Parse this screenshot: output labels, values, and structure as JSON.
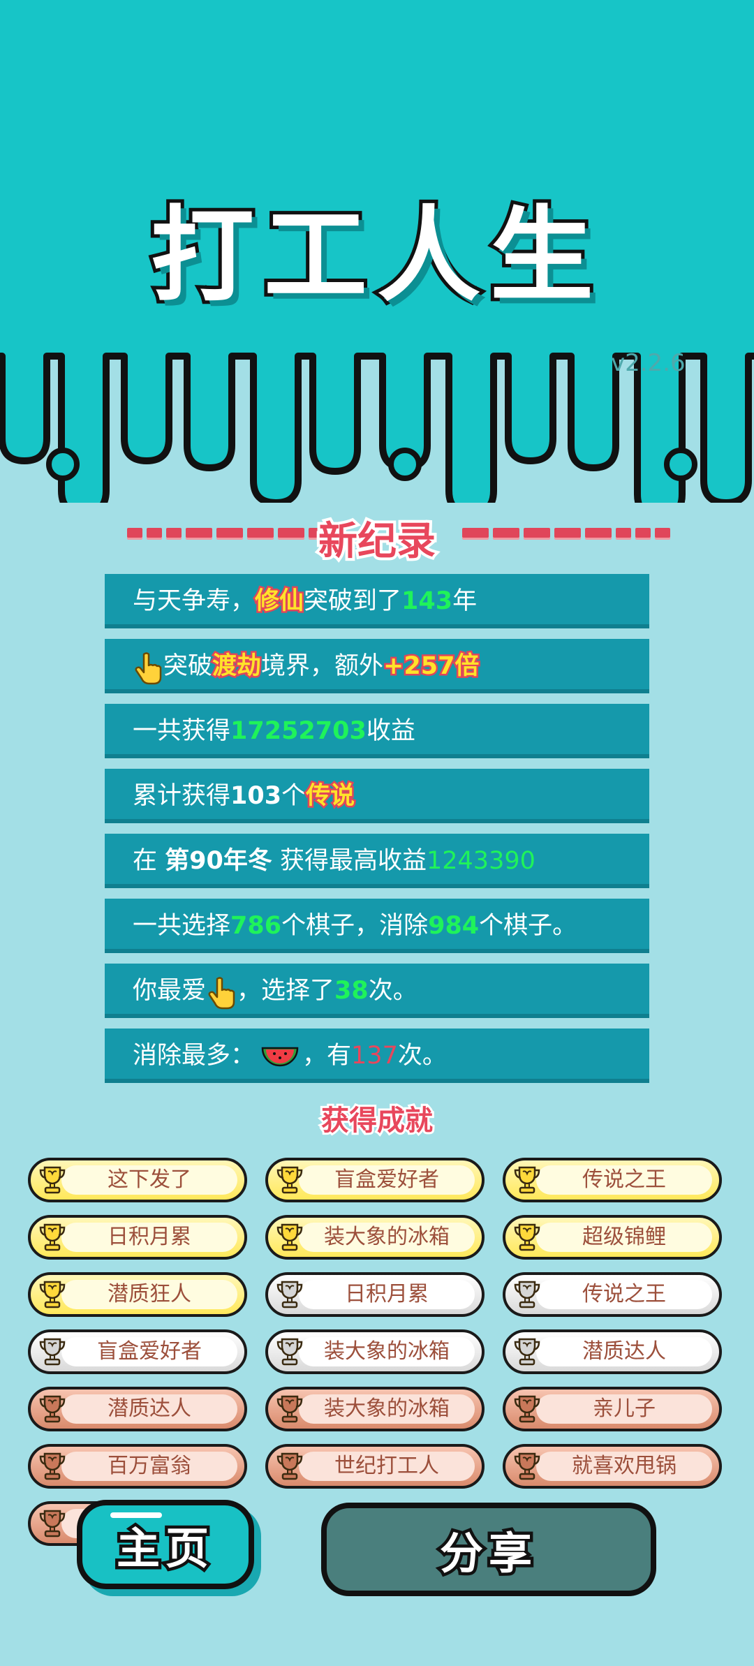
{
  "game": {
    "title": "打工人生",
    "version": "v2.2.6"
  },
  "record": {
    "title": "新纪录",
    "rows": [
      {
        "parts": [
          {
            "t": "与天争寿，"
          },
          {
            "t": "修仙",
            "s": "yellow"
          },
          {
            "t": "突破到了"
          },
          {
            "t": "143",
            "s": "green"
          },
          {
            "t": "年"
          }
        ]
      },
      {
        "parts": [
          {
            "icon": "pointing-hand-icon"
          },
          {
            "t": "突破"
          },
          {
            "t": "渡劫",
            "s": "yellow"
          },
          {
            "t": "境界，额外"
          },
          {
            "t": "+257倍",
            "s": "yellow"
          }
        ]
      },
      {
        "parts": [
          {
            "t": "一共获得"
          },
          {
            "t": "17252703",
            "s": "green"
          },
          {
            "t": "收益"
          }
        ]
      },
      {
        "parts": [
          {
            "t": "累计获得"
          },
          {
            "t": "103",
            "s": "bold"
          },
          {
            "t": "个"
          },
          {
            "t": "传说",
            "s": "yellow"
          }
        ]
      },
      {
        "parts": [
          {
            "t": "在 "
          },
          {
            "t": "第90年冬",
            "s": "bold"
          },
          {
            "t": " 获得最高收益"
          },
          {
            "t": "1243390",
            "s": "green-light"
          }
        ]
      },
      {
        "parts": [
          {
            "t": "一共选择"
          },
          {
            "t": "786",
            "s": "green"
          },
          {
            "t": "个棋子，消除"
          },
          {
            "t": "984",
            "s": "green"
          },
          {
            "t": "个棋子。"
          }
        ]
      },
      {
        "parts": [
          {
            "t": "你最爱"
          },
          {
            "icon": "pointing-hand-icon"
          },
          {
            "t": "，选择了"
          },
          {
            "t": "38",
            "s": "green"
          },
          {
            "t": "次。"
          }
        ]
      },
      {
        "parts": [
          {
            "t": "消除最多："
          },
          {
            "icon": "watermelon-icon"
          },
          {
            "t": "，有"
          },
          {
            "t": "137",
            "s": "red"
          },
          {
            "t": "次。"
          }
        ]
      }
    ]
  },
  "achievements": {
    "title": "获得成就",
    "items": [
      {
        "label": "这下发了",
        "tier": "gold"
      },
      {
        "label": "盲盒爱好者",
        "tier": "gold"
      },
      {
        "label": "传说之王",
        "tier": "gold"
      },
      {
        "label": "日积月累",
        "tier": "gold"
      },
      {
        "label": "装大象的冰箱",
        "tier": "gold"
      },
      {
        "label": "超级锦鲤",
        "tier": "gold"
      },
      {
        "label": "潜质狂人",
        "tier": "gold"
      },
      {
        "label": "日积月累",
        "tier": "silver"
      },
      {
        "label": "传说之王",
        "tier": "silver"
      },
      {
        "label": "盲盒爱好者",
        "tier": "silver"
      },
      {
        "label": "装大象的冰箱",
        "tier": "silver"
      },
      {
        "label": "潜质达人",
        "tier": "silver"
      },
      {
        "label": "潜质达人",
        "tier": "bronze"
      },
      {
        "label": "装大象的冰箱",
        "tier": "bronze"
      },
      {
        "label": "亲儿子",
        "tier": "bronze"
      },
      {
        "label": "百万富翁",
        "tier": "bronze"
      },
      {
        "label": "世纪打工人",
        "tier": "bronze"
      },
      {
        "label": "就喜欢甩锅",
        "tier": "bronze"
      },
      {
        "label": "",
        "tier": "bronze"
      }
    ]
  },
  "buttons": {
    "home": "主页",
    "share": "分享"
  },
  "colors": {
    "teal_top": "#17c5c7",
    "panel_bg": "#a3dfe6",
    "row_bg": "#1599ab",
    "accent_red": "#e8475c",
    "highlight_green": "#1ff35a",
    "highlight_yellow": "#ffe32a"
  }
}
